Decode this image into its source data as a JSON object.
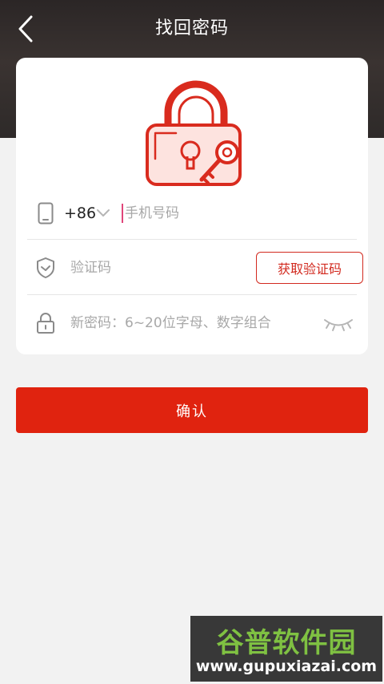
{
  "header": {
    "title": "找回密码",
    "back_icon": "chevron-left-icon"
  },
  "form": {
    "phone": {
      "icon": "phone-icon",
      "country_code": "+86",
      "dropdown_icon": "chevron-down-icon",
      "placeholder": "手机号码",
      "value": ""
    },
    "code": {
      "icon": "shield-icon",
      "placeholder": "验证码",
      "value": "",
      "get_code_label": "获取验证码"
    },
    "password": {
      "icon": "lock-icon",
      "placeholder": "新密码：6~20位字母、数字组合",
      "value": "",
      "toggle_icon": "eye-closed-icon"
    }
  },
  "confirm_label": "确认",
  "watermark": {
    "title": "谷普软件园",
    "url": "www.gupuxiazai.com"
  },
  "colors": {
    "accent": "#e0230f",
    "header_bg": "#2b2626",
    "lock_illustration": "#d92b1e"
  }
}
